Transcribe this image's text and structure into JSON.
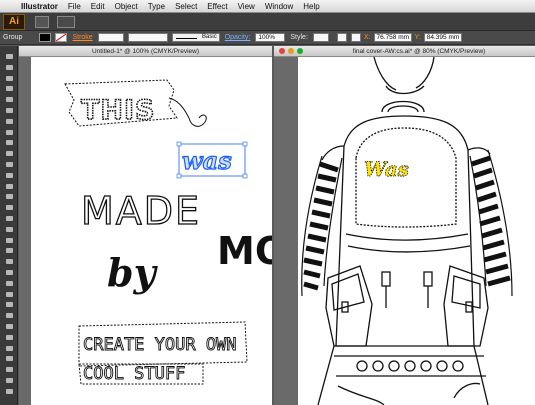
{
  "menubar": {
    "app": "Illustrator",
    "items": [
      "File",
      "Edit",
      "Object",
      "Type",
      "Select",
      "Effect",
      "View",
      "Window",
      "Help"
    ]
  },
  "appbar": {
    "logo": "Ai"
  },
  "control": {
    "selection": "Group",
    "stroke_label": "Stroke",
    "stroke_style": "Basic",
    "opacity_label": "Opacity:",
    "opacity_value": "100%",
    "style_label": "Style:",
    "x_label": "X:",
    "x_value": "76.758 mm",
    "y_label": "Y:",
    "y_value": "84.395 mm"
  },
  "documents": [
    {
      "title": "Untitled-1* @ 100% (CMYK/Preview)",
      "active": false
    },
    {
      "title": "final cover-AW:cs.ai* @ 80% (CMYK/Preview)",
      "active": true
    }
  ],
  "artwork": {
    "word1": "THIS",
    "word2": "was",
    "word3": "MADE",
    "word4": "by",
    "cropped_letters": "MO",
    "line1": "CREATE YOUR OWN",
    "line2": "COOL STUFF",
    "bag_label": "Was"
  },
  "colors": {
    "selection_blue": "#1a5cff",
    "highlight_yellow": "#ffe600",
    "stroke_orange": "#ff8c1a"
  },
  "tools": [
    "selection-tool",
    "direct-selection-tool",
    "magic-wand-tool",
    "lasso-tool",
    "pen-tool",
    "type-tool",
    "line-segment-tool",
    "rectangle-tool",
    "paintbrush-tool",
    "pencil-tool",
    "blob-brush-tool",
    "eraser-tool",
    "rotate-tool",
    "scale-tool",
    "width-tool",
    "free-transform-tool",
    "shape-builder-tool",
    "perspective-grid-tool",
    "mesh-tool",
    "gradient-tool",
    "eyedropper-tool",
    "blend-tool",
    "symbol-sprayer-tool",
    "column-graph-tool",
    "artboard-tool",
    "slice-tool",
    "hand-tool",
    "zoom-tool",
    "fill-stroke-swatch",
    "swap-colors",
    "color-mode",
    "screen-mode"
  ]
}
